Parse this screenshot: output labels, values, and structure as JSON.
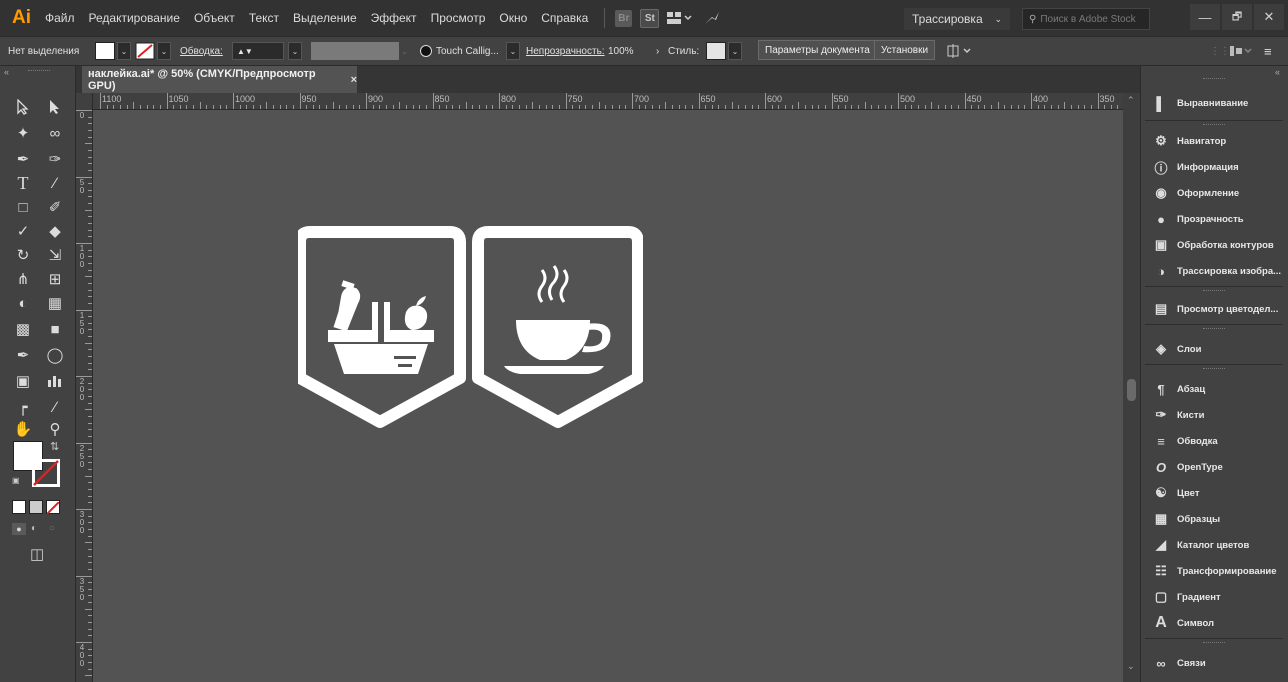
{
  "menubar": {
    "logo": "Ai",
    "items": [
      "Файл",
      "Редактирование",
      "Объект",
      "Текст",
      "Выделение",
      "Эффект",
      "Просмотр",
      "Окно",
      "Справка"
    ],
    "bridge_icon": "Br",
    "stock_icon": "St",
    "workspace": "Трассировка",
    "search_placeholder": "Поиск в Adobe Stock",
    "window_buttons": [
      "—",
      "🗗",
      "✕"
    ]
  },
  "controlbar": {
    "selection_label": "Нет выделения",
    "stroke_label": "Обводка:",
    "brush_label": "Touch Callig...",
    "opacity_label": "Непрозрачность:",
    "opacity_value": "100%",
    "style_label": "Стиль:",
    "doc_settings_button": "Параметры документа",
    "prefs_button": "Установки"
  },
  "document": {
    "tab_title": "наклейка.ai* @ 50% (CMYK/Предпросмотр GPU)",
    "tab_close": "×"
  },
  "rulers": {
    "horizontal_labels": [
      "1100",
      "1050",
      "1000",
      "950",
      "900",
      "850",
      "800",
      "750",
      "700",
      "650",
      "600",
      "550",
      "500",
      "450",
      "400",
      "350"
    ],
    "vertical_labels": [
      "0",
      "50",
      "100",
      "150",
      "200",
      "250",
      "300",
      "350",
      "400"
    ]
  },
  "artwork": {
    "badges": [
      {
        "icon": "grocery-basket-icon"
      },
      {
        "icon": "coffee-cup-icon"
      }
    ],
    "fill_color": "#ffffff"
  },
  "panels": {
    "items": [
      {
        "label": "Выравнивание",
        "icon": "align-icon"
      },
      {
        "label": "Навигатор",
        "icon": "navigator-icon"
      },
      {
        "label": "Информация",
        "icon": "info-icon"
      },
      {
        "label": "Оформление",
        "icon": "appearance-icon"
      },
      {
        "label": "Прозрачность",
        "icon": "transparency-icon"
      },
      {
        "label": "Обработка контуров",
        "icon": "pathfinder-icon"
      },
      {
        "label": "Трассировка изобра...",
        "icon": "image-trace-icon"
      },
      {
        "label": "Просмотр цветодел...",
        "icon": "separations-icon"
      },
      {
        "label": "Слои",
        "icon": "layers-icon"
      },
      {
        "label": "Абзац",
        "icon": "paragraph-icon"
      },
      {
        "label": "Кисти",
        "icon": "brushes-icon"
      },
      {
        "label": "Обводка",
        "icon": "stroke-icon"
      },
      {
        "label": "OpenType",
        "icon": "opentype-icon"
      },
      {
        "label": "Цвет",
        "icon": "color-icon"
      },
      {
        "label": "Образцы",
        "icon": "swatches-icon"
      },
      {
        "label": "Каталог цветов",
        "icon": "color-guide-icon"
      },
      {
        "label": "Трансформирование",
        "icon": "transform-icon"
      },
      {
        "label": "Градиент",
        "icon": "gradient-icon"
      },
      {
        "label": "Символ",
        "icon": "character-icon"
      },
      {
        "label": "Связи",
        "icon": "links-icon"
      }
    ]
  }
}
